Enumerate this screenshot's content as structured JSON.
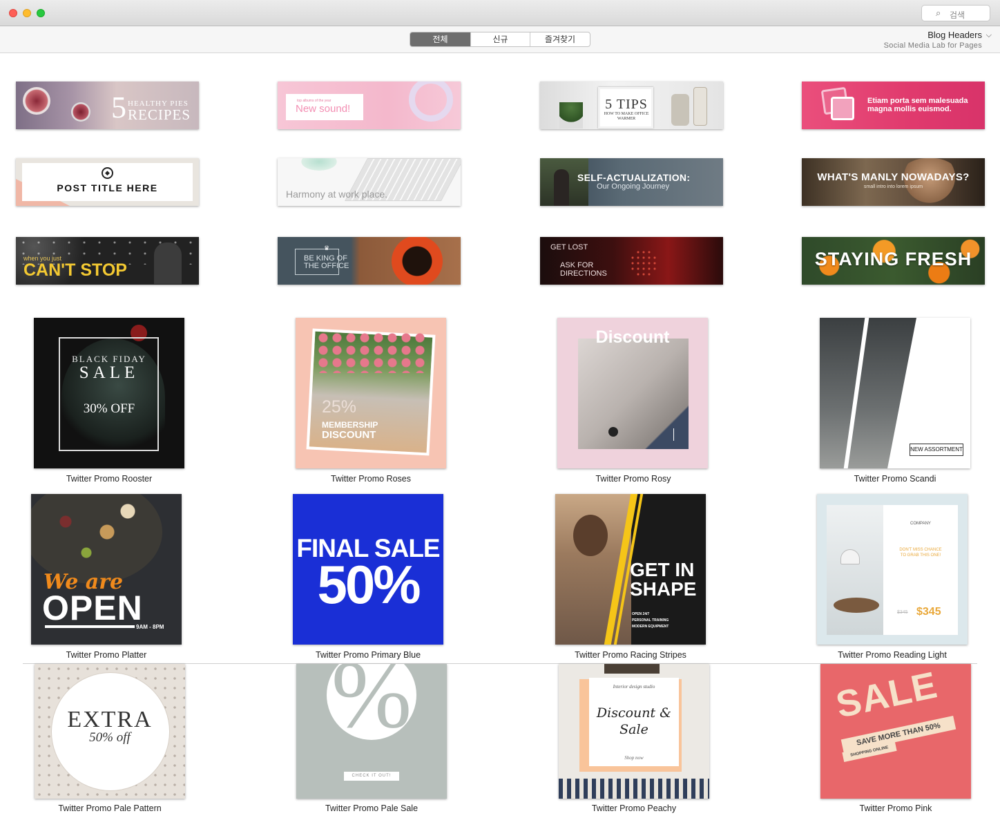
{
  "window": {
    "search_placeholder": "검색"
  },
  "toolbar": {
    "tabs": [
      "전체",
      "신규",
      "즐겨찾기"
    ],
    "active_tab": "전체",
    "doc_title": "Blog Headers",
    "doc_subtitle": "Social Media Lab for Pages"
  },
  "banners": {
    "b1_small": "HEALTHY PIES",
    "b1_big": "RECIPES",
    "b1_num": "5",
    "b2_small": "top albums of the year",
    "b2_title": "New sound!",
    "b3_big": "5 TIPS",
    "b3_small": "HOW TO MAKE OFFICE WARMER",
    "b4_text": "Etiam porta sem malesuada magna mollis euismod.",
    "b5_title": "POST TITLE HERE",
    "b6_title": "Harmony at work place.",
    "b7_title": "SELF-ACTUALIZATION:",
    "b7_sub": "Our Ongoing Journey",
    "b8_title": "WHAT'S MANLY NOWADAYS?",
    "b8_sub": "small intro into lorem ipsum",
    "b9_small": "when you just",
    "b9_big": "CAN'T STOP",
    "b10_l1": "BE KING OF",
    "b10_l2": "THE OFFICE",
    "b11_l1": "GET LOST",
    "b11_l2": "ASK FOR",
    "b11_l3": "DIRECTIONS",
    "b12_title": "STAYING FRESH"
  },
  "templates": [
    {
      "name": "Twitter Promo Rooster",
      "l1": "BLACK FIDAY",
      "l2": "SALE",
      "l3": "30% OFF"
    },
    {
      "name": "Twitter Promo Roses",
      "l1": "25%",
      "l2": "MEMBERSHIP",
      "l3": "DISCOUNT"
    },
    {
      "name": "Twitter Promo Rosy",
      "l1": "Discount"
    },
    {
      "name": "Twitter Promo Scandi",
      "l1": "NEW ASSORTMENT"
    },
    {
      "name": "Twitter Promo Platter",
      "l1": "We are",
      "l2": "OPEN",
      "l3": "9AM - 8PM"
    },
    {
      "name": "Twitter Promo Primary Blue",
      "l1": "FINAL SALE",
      "l2": "50%"
    },
    {
      "name": "Twitter Promo Racing Stripes",
      "l1": "GET IN",
      "l2": "SHAPE",
      "l3": "OPEN 24/7",
      "l4": "PERSONAL TRAINING",
      "l5": "MODERN EQUIPMENT"
    },
    {
      "name": "Twitter Promo Reading Light",
      "l1": "COMPANY",
      "l2": "DON'T MISS CHANCE TO GRAB THIS ONE!",
      "l3": "$345",
      "l4": "$345"
    },
    {
      "name": "Twitter Promo Pale Pattern",
      "l1": "EXTRA",
      "l2": "50% off"
    },
    {
      "name": "Twitter Promo Pale Sale",
      "l1": "%",
      "l2": "CHECK IT OUT!"
    },
    {
      "name": "Twitter Promo Peachy",
      "l1": "Interior design studio",
      "l2": "Discount &",
      "l3": "Sale",
      "l4": "Shop now"
    },
    {
      "name": "Twitter Promo Pink",
      "l1": "SALE",
      "l2": "SAVE MORE THAN 50%",
      "l3": "SHOPPING ONLINE"
    }
  ],
  "colors": {
    "accent_pink": "#e03a6d",
    "primary_blue": "#1a2fd6",
    "gold": "#f5c518",
    "orange": "#f08a1c",
    "sale_red": "#e8676a"
  }
}
